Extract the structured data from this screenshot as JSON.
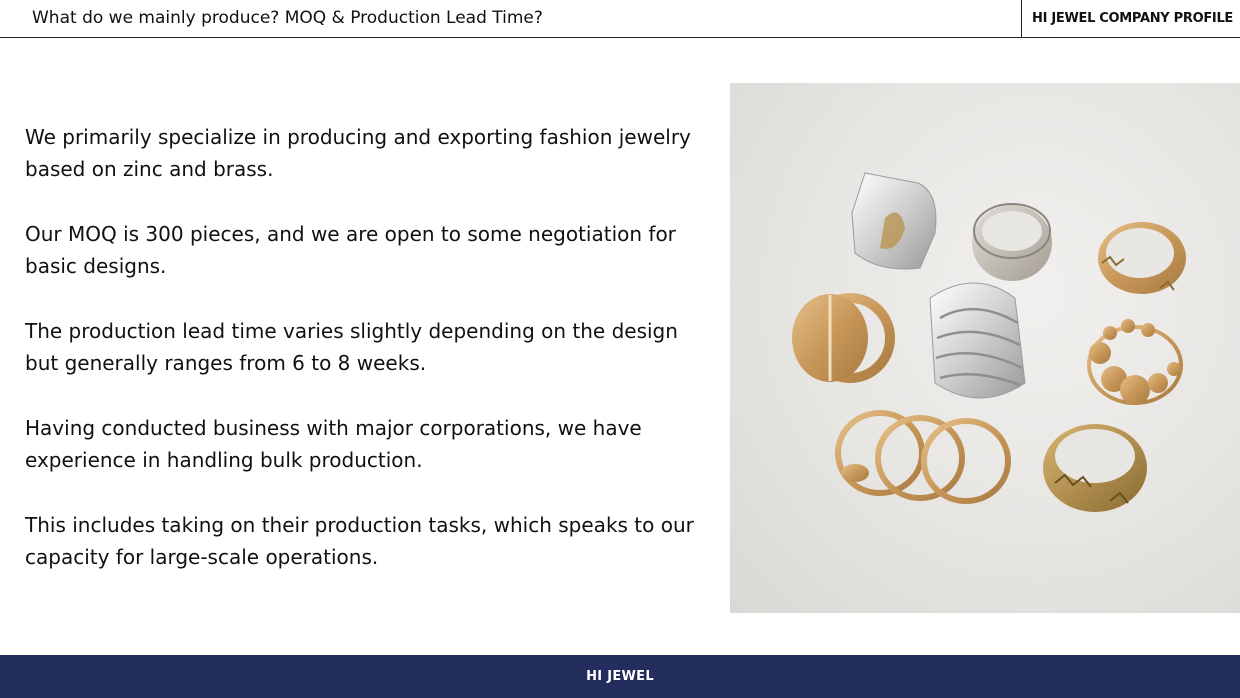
{
  "header": {
    "title": "What do we mainly produce? MOQ & Production Lead Time?",
    "brand": "HI JEWEL COMPANY PROFILE"
  },
  "content": {
    "paragraphs": [
      "We primarily specialize in producing and exporting fashion jewelry based on zinc and brass.",
      "Our MOQ is 300 pieces, and we are open to some negotiation for basic designs.",
      "The production lead time varies slightly depending on the design but generally ranges from 6 to 8 weeks.",
      "Having conducted business with major corporations, we have experience in handling bulk production.",
      "This includes taking on their production tasks, which speaks to our capacity for large-scale operations."
    ]
  },
  "photo": {
    "subject": "rings-photo",
    "colors": {
      "gold": "#c99a5a",
      "silver": "#d8d8d8"
    }
  },
  "footer": {
    "text": "HI JEWEL"
  },
  "colors": {
    "footer_bg": "#232d5e",
    "footer_text": "#ffffff"
  }
}
